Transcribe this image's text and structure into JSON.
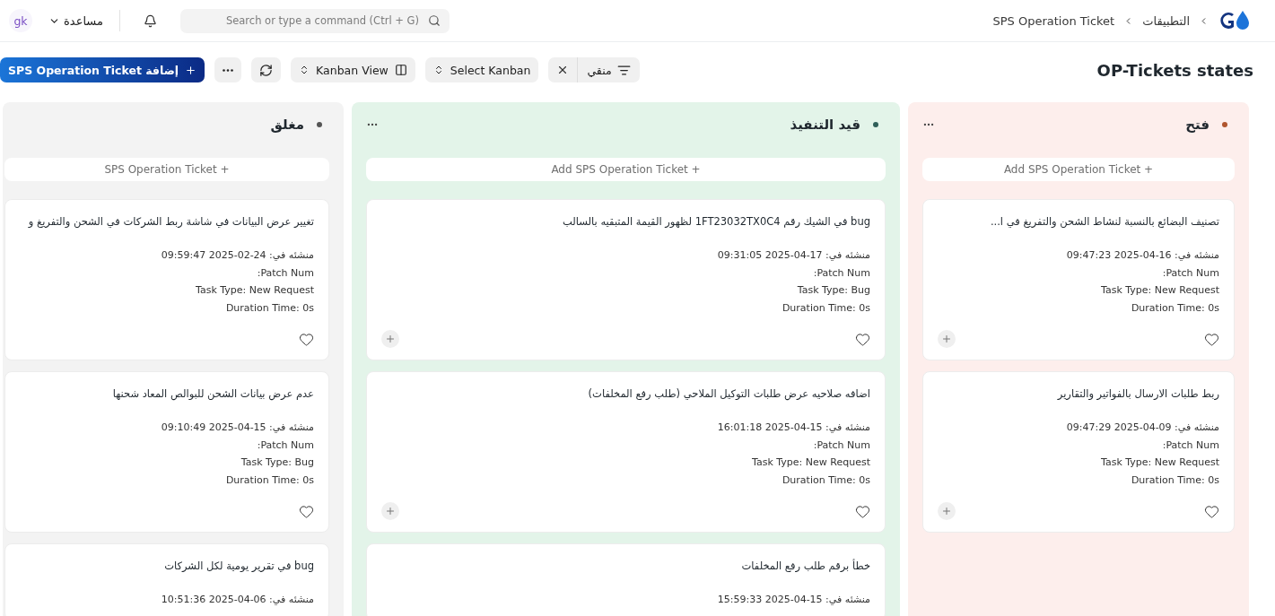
{
  "topbar": {
    "breadcrumbs": [
      {
        "label": "التطبيقات"
      },
      {
        "label": "SPS Operation Ticket"
      }
    ],
    "search": {
      "placeholder": "Search or type a command (Ctrl + G)"
    },
    "help": "مساعدة",
    "avatar": "gk"
  },
  "toolbar": {
    "title": "OP-Tickets states",
    "filter": "منقي",
    "select_kanban": "Select Kanban",
    "view": "Kanban View",
    "add_button": "إضافة SPS Operation Ticket"
  },
  "columns": [
    {
      "title": "فتح",
      "kind": "open",
      "color": "#b0552e",
      "add_label": "+ Add SPS Operation Ticket",
      "clipped": false,
      "cards": [
        {
          "title": "تصنيف البضائع بالنسبة لنشاط الشحن والتفريغ في ا...",
          "created": "منشئه في: ‏2025-04-16 09:47:23",
          "patch": "Patch Num:",
          "task_type": "Task Type: New Request",
          "duration": "Duration Time: 0s"
        },
        {
          "title": "ربط طلبات الارسال بالفواتير والتقارير",
          "created": "منشئه في: ‏2025-04-09 09:47:29",
          "patch": "Patch Num:",
          "task_type": "Task Type: New Request",
          "duration": "Duration Time: 0s"
        }
      ]
    },
    {
      "title": "قيد التنفيذ",
      "kind": "progress",
      "color": "#2f5f58",
      "add_label": "+ Add SPS Operation Ticket",
      "clipped": false,
      "cards": [
        {
          "title": "bug في الشيك رقم 1FT23032TX0C4 لظهور القيمة المتبقيه بالسالب",
          "created": "منشئه في: ‏2025-04-17 09:31:05",
          "patch": "Patch Num:",
          "task_type": "Task Type: Bug",
          "duration": "Duration Time: 0s"
        },
        {
          "title": "اضافه صلاحيه عرض طلبات التوكيل الملاحي (طلب رفع المخلفات)",
          "created": "منشئه في: ‏2025-04-15 16:01:18",
          "patch": "Patch Num:",
          "task_type": "Task Type: New Request",
          "duration": "Duration Time: 0s"
        },
        {
          "title": "خطأ برقم طلب رفع المخلفات",
          "created": "منشئه في: ‏2025-04-15 15:59:33"
        }
      ]
    },
    {
      "title": "مغلق",
      "kind": "closed",
      "color": "#555555",
      "add_label": "+ SPS Operation Ticket",
      "clipped": true,
      "cards": [
        {
          "title": "تغيير عرض البيانات في شاشة ربط الشركات في الشحن والتفريغ و",
          "created": "منشئه في: ‏2025-02-24 09:59:47",
          "patch": "Patch Num:",
          "task_type": "Task Type: New Request",
          "duration": "Duration Time: 0s"
        },
        {
          "title": "عدم عرض بيانات الشحن للبوالص المعاد شحنها",
          "created": "منشئه في: ‏2025-04-15 09:10:49",
          "patch": "Patch Num:",
          "task_type": "Task Type: Bug",
          "duration": "Duration Time: 0s"
        },
        {
          "title": "bug في تقرير يومية لكل الشركات",
          "created": "منشئه في: ‏2025-04-06 10:51:36"
        }
      ]
    }
  ]
}
